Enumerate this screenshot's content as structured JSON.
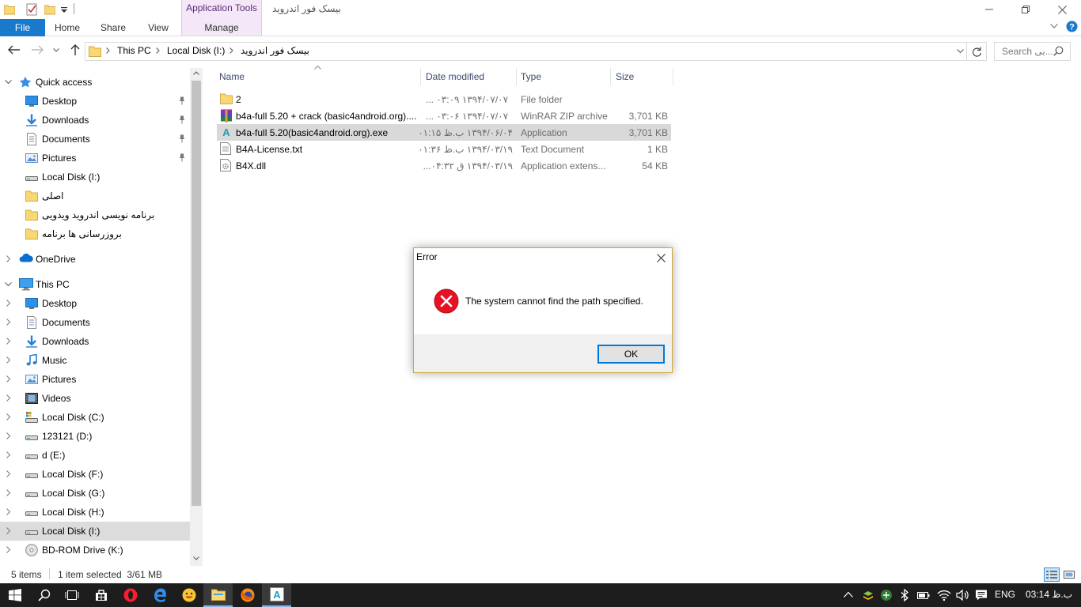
{
  "window": {
    "title": "بیسک فور اندروید",
    "context_tab_group": "Application Tools"
  },
  "ribbon": {
    "tabs": [
      {
        "label": "File"
      },
      {
        "label": "Home"
      },
      {
        "label": "Share"
      },
      {
        "label": "View"
      },
      {
        "label": "Manage"
      }
    ]
  },
  "address": {
    "crumbs": [
      "This PC",
      "Local Disk (I:)",
      "بیسک فور اندروید"
    ],
    "search_placeholder": "Search بی..."
  },
  "nav": {
    "items": [
      {
        "label": "Quick access",
        "icon": "star-icon",
        "level": 0,
        "chevron": "down"
      },
      {
        "label": "Desktop",
        "icon": "desktop-icon",
        "level": 1,
        "pinned": true
      },
      {
        "label": "Downloads",
        "icon": "downloads-icon",
        "level": 1,
        "pinned": true
      },
      {
        "label": "Documents",
        "icon": "documents-icon",
        "level": 1,
        "pinned": true
      },
      {
        "label": "Pictures",
        "icon": "pictures-icon",
        "level": 1,
        "pinned": true
      },
      {
        "label": "Local Disk (I:)",
        "icon": "drive-icon",
        "level": 1
      },
      {
        "label": "اصلی",
        "icon": "folder-icon",
        "level": 1
      },
      {
        "label": "برنامه نویسی اندروید ویدویی",
        "icon": "folder-icon",
        "level": 1
      },
      {
        "label": "بروزرسانی ها برنامه",
        "icon": "folder-icon",
        "level": 1
      },
      {
        "label": "OneDrive",
        "icon": "onedrive-icon",
        "level": 0,
        "chevron": "right"
      },
      {
        "label": "This PC",
        "icon": "computer-icon",
        "level": 0,
        "chevron": "down"
      },
      {
        "label": "Desktop",
        "icon": "desktop-icon",
        "level": 1,
        "chevron": "right"
      },
      {
        "label": "Documents",
        "icon": "documents-icon",
        "level": 1,
        "chevron": "right"
      },
      {
        "label": "Downloads",
        "icon": "downloads-icon",
        "level": 1,
        "chevron": "right"
      },
      {
        "label": "Music",
        "icon": "music-icon",
        "level": 1,
        "chevron": "right"
      },
      {
        "label": "Pictures",
        "icon": "pictures-icon",
        "level": 1,
        "chevron": "right"
      },
      {
        "label": "Videos",
        "icon": "videos-icon",
        "level": 1,
        "chevron": "right"
      },
      {
        "label": "Local Disk (C:)",
        "icon": "system-drive-icon",
        "level": 1,
        "chevron": "right"
      },
      {
        "label": "123121 (D:)",
        "icon": "drive-icon",
        "level": 1,
        "chevron": "right"
      },
      {
        "label": "d (E:)",
        "icon": "drive-icon",
        "level": 1,
        "chevron": "right"
      },
      {
        "label": "Local Disk (F:)",
        "icon": "drive-icon",
        "level": 1,
        "chevron": "right"
      },
      {
        "label": "Local Disk (G:)",
        "icon": "drive-icon",
        "level": 1,
        "chevron": "right"
      },
      {
        "label": "Local Disk (H:)",
        "icon": "drive-icon",
        "level": 1,
        "chevron": "right"
      },
      {
        "label": "Local Disk (I:)",
        "icon": "drive-icon",
        "level": 1,
        "chevron": "right",
        "selected": true
      },
      {
        "label": "BD-ROM Drive (K:)",
        "icon": "disc-icon",
        "level": 1,
        "chevron": "right"
      }
    ]
  },
  "columns": {
    "name": "Name",
    "date": "Date modified",
    "type": "Type",
    "size": "Size"
  },
  "files": [
    {
      "name": "2",
      "date": "۱۳۹۴/۰۷/۰۷ ۰۳:۰۹ ...",
      "type": "File folder",
      "size": "",
      "icon": "folder-icon"
    },
    {
      "name": "b4a-full 5.20 + crack (basic4android.org)....",
      "date": "۱۳۹۴/۰۷/۰۷ ۰۳:۰۶ ...",
      "type": "WinRAR ZIP archive",
      "size": "3,701 KB",
      "icon": "winrar-archive-icon"
    },
    {
      "name": "b4a-full 5.20(basic4android.org).exe",
      "date": "۱۳۹۴/۰۶/۰۴ ب.ظ ۰۱:۱۵",
      "type": "Application",
      "size": "3,701 KB",
      "icon": "b4a-app-icon",
      "selected": true
    },
    {
      "name": "B4A-License.txt",
      "date": "۱۳۹۴/۰۳/۱۹ ب.ظ ۰۱:۳۶",
      "type": "Text Document",
      "size": "1 KB",
      "icon": "text-file-icon"
    },
    {
      "name": "B4X.dll",
      "date": "۱۳۹۴/۰۳/۱۹ ق ۰۴:۳۲...",
      "type": "Application extens...",
      "size": "54 KB",
      "icon": "dll-file-icon"
    }
  ],
  "status": {
    "count": "5 items",
    "selection": "1 item selected  3/61 MB"
  },
  "dialog": {
    "title": "Error",
    "message": "The system cannot find the path specified.",
    "ok_label": "OK"
  },
  "taskbar": {
    "language": "ENG",
    "clock": "03:14 ب.ظ"
  },
  "colors": {
    "accent": "#1979ca",
    "error": "#e81123",
    "folder": "#f8d775"
  }
}
